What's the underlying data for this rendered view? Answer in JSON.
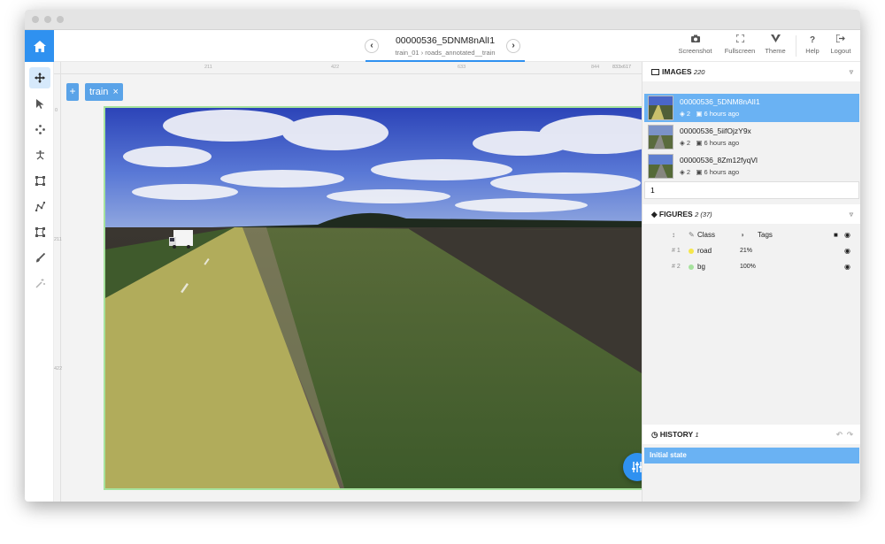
{
  "window": {
    "image_name": "00000536_5DNM8nAlI1",
    "breadcrumb_dataset": "train_01",
    "breadcrumb_separator": "›",
    "breadcrumb_project": "roads_annotated__train"
  },
  "toolbar": {
    "screenshot": "Screenshot",
    "fullscreen": "Fullscreen",
    "theme": "Theme",
    "help": "Help",
    "logout": "Logout"
  },
  "canvas": {
    "chip_plus": "+",
    "chip_label": "train",
    "chip_close": "×",
    "size_label": "833x617",
    "ruler_top": [
      "211",
      "422",
      "633",
      "844"
    ],
    "ruler_left": [
      "0",
      "211",
      "422"
    ]
  },
  "images": {
    "title": "IMAGES",
    "count": "220",
    "items": [
      {
        "name": "00000536_5DNM8nAlI1",
        "figures": "2",
        "time": "6 hours ago"
      },
      {
        "name": "00000536_5iifOjzY9x",
        "figures": "2",
        "time": "6 hours ago"
      },
      {
        "name": "00000536_8Zm12fyqVl",
        "figures": "2",
        "time": "6 hours ago"
      }
    ],
    "page_input": "1"
  },
  "figures": {
    "title": "FIGURES",
    "count": "2 (37)",
    "col_class": "Class",
    "col_tags": "Tags",
    "rows": [
      {
        "idx": "# 1",
        "name": "road",
        "area": "21%",
        "color": "#f5e64a"
      },
      {
        "idx": "# 2",
        "name": "bg",
        "area": "100%",
        "color": "#a6e29d"
      }
    ]
  },
  "history": {
    "title": "HISTORY",
    "count": "1",
    "items": [
      "Initial state"
    ]
  },
  "colors": {
    "accent": "#2f91f0",
    "selection": "#6ab2f3",
    "road_class": "#f5e64a",
    "bg_class": "#a6e29d"
  }
}
